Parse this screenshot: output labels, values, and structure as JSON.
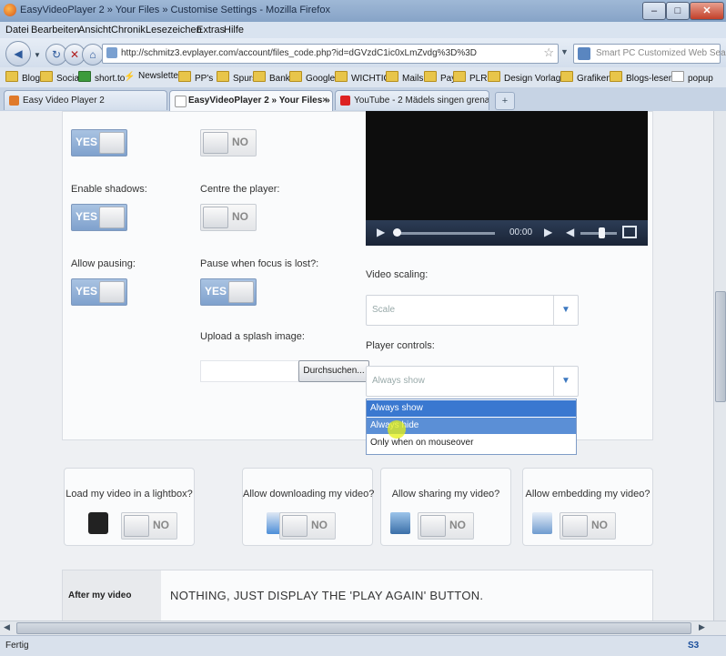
{
  "window": {
    "title": "EasyVideoPlayer 2 » Your Files » Customise Settings - Mozilla Firefox"
  },
  "menu": [
    "Datei",
    "Bearbeiten",
    "Ansicht",
    "Chronik",
    "Lesezeichen",
    "Extras",
    "Hilfe"
  ],
  "nav": {
    "url": "http://schmitz3.evplayer.com/account/files_code.php?id=dGVzdC1ic0xLmZvdg%3D%3D",
    "search_placeholder": "Smart PC Customized Web Search"
  },
  "bookmarks": [
    "Blogs",
    "Social",
    "short.to",
    "Newsletter",
    "PP's",
    "Spurs",
    "Bank",
    "Google",
    "WICHTIG!",
    "Mails",
    "Pay",
    "PLR",
    "Design Vorlagen",
    "Grafiken",
    "Blogs-lesen",
    "popup"
  ],
  "tabs": [
    {
      "label": "Easy Video Player 2",
      "active": false
    },
    {
      "label": "EasyVideoPlayer 2 » Your Files » C...",
      "active": true
    },
    {
      "label": "YouTube - 2 Mädels singen grenad...",
      "active": false
    }
  ],
  "settings": {
    "row1": {
      "left_value": "YES",
      "right_value": "NO"
    },
    "enable_shadows": {
      "label": "Enable shadows:",
      "value": "YES"
    },
    "centre_player": {
      "label": "Centre the player:",
      "value": "NO"
    },
    "allow_pausing": {
      "label": "Allow pausing:",
      "value": "YES"
    },
    "pause_focus": {
      "label": "Pause when focus is lost?:",
      "value": "YES"
    },
    "splash": {
      "label": "Upload a splash image:",
      "browse": "Durchsuchen..."
    },
    "video_scaling": {
      "label": "Video scaling:",
      "value": "Scale"
    },
    "player_controls": {
      "label": "Player controls:",
      "value": "Always show",
      "options": [
        "Always show",
        "Always hide",
        "Only when on mouseover"
      ]
    }
  },
  "video": {
    "time": "00:00"
  },
  "cards": [
    {
      "label": "Load my video in a lightbox?",
      "value": "NO",
      "icon": "camera-icon"
    },
    {
      "label": "Allow downloading my video?",
      "value": "NO",
      "icon": "download-icon"
    },
    {
      "label": "Allow sharing my video?",
      "value": "NO",
      "icon": "share-icon"
    },
    {
      "label": "Allow embedding my video?",
      "value": "NO",
      "icon": "embed-icon"
    }
  ],
  "after_video": {
    "label": "After my video",
    "value": "NOTHING, JUST DISPLAY THE 'PLAY AGAIN' BUTTON."
  },
  "status": "Fertig",
  "colors": {
    "accent": "#3a78d0",
    "toggle_yes": "#8faad2"
  }
}
